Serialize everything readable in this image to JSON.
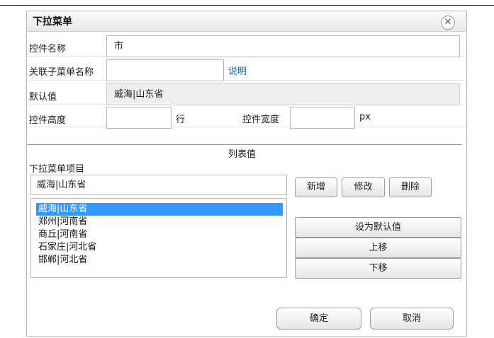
{
  "dialog": {
    "title": "下拉菜单"
  },
  "form": {
    "control_name_label": "控件名称",
    "control_name_value": "市",
    "submenu_name_label": "关联子菜单名称",
    "submenu_name_value": "",
    "help_link": "说明",
    "default_value_label": "默认值",
    "default_value_value": "威海|山东省",
    "height_label": "控件高度",
    "height_value": "",
    "height_unit": "行",
    "width_label": "控件宽度",
    "width_value": "",
    "width_unit": "px"
  },
  "list_section": {
    "header": "列表值",
    "items_label": "下拉菜单项目",
    "item_input_value": "威海|山东省",
    "add_button": "新增",
    "edit_button": "修改",
    "delete_button": "删除",
    "items": [
      "威海|山东省",
      "郑州|河南省",
      "商丘|河南省",
      "石家庄|河北省",
      "邯郸|河北省"
    ],
    "selected_index": 0,
    "set_default_button": "设为默认值",
    "move_up_button": "上移",
    "move_down_button": "下移"
  },
  "footer": {
    "ok_button": "确定",
    "cancel_button": "取消"
  },
  "colors": {
    "selection": "#3399ff",
    "link": "#1f5fa6"
  }
}
